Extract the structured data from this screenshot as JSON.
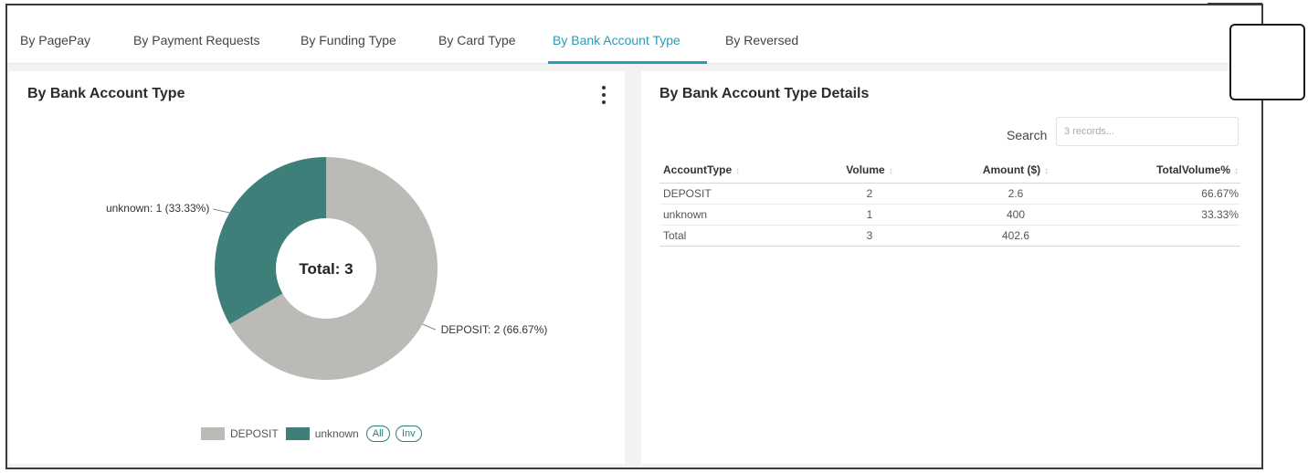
{
  "tabs": [
    {
      "label": "By PagePay"
    },
    {
      "label": "By Payment Requests"
    },
    {
      "label": "By Funding Type"
    },
    {
      "label": "By Card Type"
    },
    {
      "label": "By Bank Account Type",
      "active": true
    },
    {
      "label": "By Reversed"
    }
  ],
  "left_panel": {
    "title": "By Bank Account Type",
    "menu_icon": "kebab-vertical-icon",
    "center_label": "Total: 3",
    "slice_labels": {
      "unknown": "unknown: 1 (33.33%)",
      "deposit": "DEPOSIT: 2 (66.67%)"
    },
    "legend": {
      "items": [
        {
          "label": "DEPOSIT",
          "color": "#bcbab7"
        },
        {
          "label": "unknown",
          "color": "#3e7f7a"
        }
      ],
      "all_label": "All",
      "inv_label": "Inv"
    }
  },
  "chart_data": {
    "type": "pie",
    "donut": true,
    "categories": [
      "DEPOSIT",
      "unknown"
    ],
    "values": [
      2,
      1
    ],
    "percentages": [
      66.67,
      33.33
    ],
    "colors": [
      "#bcbab7",
      "#3e7f7a"
    ],
    "title": "By Bank Account Type",
    "center_text": "Total: 3",
    "legend_position": "bottom"
  },
  "right_panel": {
    "title": "By Bank Account Type Details",
    "menu_icon": "kebab-vertical-icon",
    "search_label": "Search",
    "search_placeholder": "3 records...",
    "table": {
      "headers": [
        "AccountType",
        "Volume",
        "Amount ($)",
        "TotalVolume%"
      ],
      "sort_indicator": "↕",
      "rows": [
        [
          "DEPOSIT",
          "2",
          "2.6",
          "66.67%"
        ],
        [
          "unknown",
          "1",
          "400",
          "33.33%"
        ]
      ],
      "total_row": [
        "Total",
        "3",
        "402.6",
        ""
      ]
    }
  },
  "colors": {
    "accent": "#2a9bb8",
    "deposit": "#bcbab7",
    "unknown": "#3e7f7a"
  }
}
